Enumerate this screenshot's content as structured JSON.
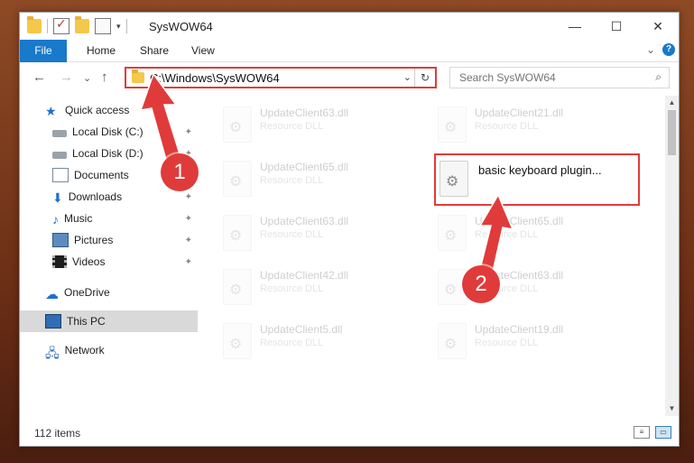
{
  "window": {
    "title": "SysWOW64",
    "controls": {
      "minimize": "—",
      "maximize": "☐",
      "close": "✕"
    }
  },
  "ribbon": {
    "tabs": [
      "File",
      "Home",
      "Share",
      "View"
    ],
    "expand": "⌄",
    "help": "?"
  },
  "nav": {
    "back": "←",
    "forward": "→",
    "recent": "⌄",
    "up": "↑",
    "address": "C:\\Windows\\SysWOW64",
    "address_dropdown": "⌄",
    "refresh": "↻",
    "search_placeholder": "Search SysWOW64",
    "search_icon": "⌕"
  },
  "sidebar": {
    "items": [
      {
        "label": "Quick access",
        "icon": "star-icon",
        "pinned": false
      },
      {
        "label": "Local Disk (C:)",
        "icon": "drive-icon",
        "pinned": true
      },
      {
        "label": "Local Disk (D:)",
        "icon": "drive-icon",
        "pinned": true
      },
      {
        "label": "Documents",
        "icon": "documents-icon",
        "pinned": true
      },
      {
        "label": "Downloads",
        "icon": "download-icon",
        "pinned": true
      },
      {
        "label": "Music",
        "icon": "music-icon",
        "pinned": true
      },
      {
        "label": "Pictures",
        "icon": "pictures-icon",
        "pinned": true
      },
      {
        "label": "Videos",
        "icon": "videos-icon",
        "pinned": true
      },
      {
        "label": "OneDrive",
        "icon": "cloud-icon",
        "pinned": false
      },
      {
        "label": "This PC",
        "icon": "computer-icon",
        "pinned": false,
        "selected": true
      },
      {
        "label": "Network",
        "icon": "network-icon",
        "pinned": false
      }
    ],
    "pin_glyph": "📌"
  },
  "files": [
    {
      "name": "UpdateClient63.dll",
      "type": "Resource DLL",
      "faded": true
    },
    {
      "name": "UpdateClient21.dll",
      "type": "Resource DLL",
      "faded": true
    },
    {
      "name": "UpdateClient65.dll",
      "type": "Resource DLL",
      "faded": true
    },
    {
      "name": "basic keyboard plugin...",
      "type": "",
      "faded": false,
      "highlighted": true
    },
    {
      "name": "UpdateClient63.dll",
      "type": "Resource DLL",
      "faded": true
    },
    {
      "name": "UpdateClient65.dll",
      "type": "Resource DLL",
      "faded": true
    },
    {
      "name": "UpdateClient42.dll",
      "type": "Resource DLL",
      "faded": true
    },
    {
      "name": "UpdateClient63.dll",
      "type": "Resource DLL",
      "faded": true
    },
    {
      "name": "UpdateClient5.dll",
      "type": "Resource DLL",
      "faded": true
    },
    {
      "name": "UpdateClient19.dll",
      "type": "Resource DLL",
      "faded": true
    }
  ],
  "status": {
    "count": "112 items"
  },
  "annotations": {
    "step1": "1",
    "step2": "2",
    "color": "#e03b3b"
  }
}
